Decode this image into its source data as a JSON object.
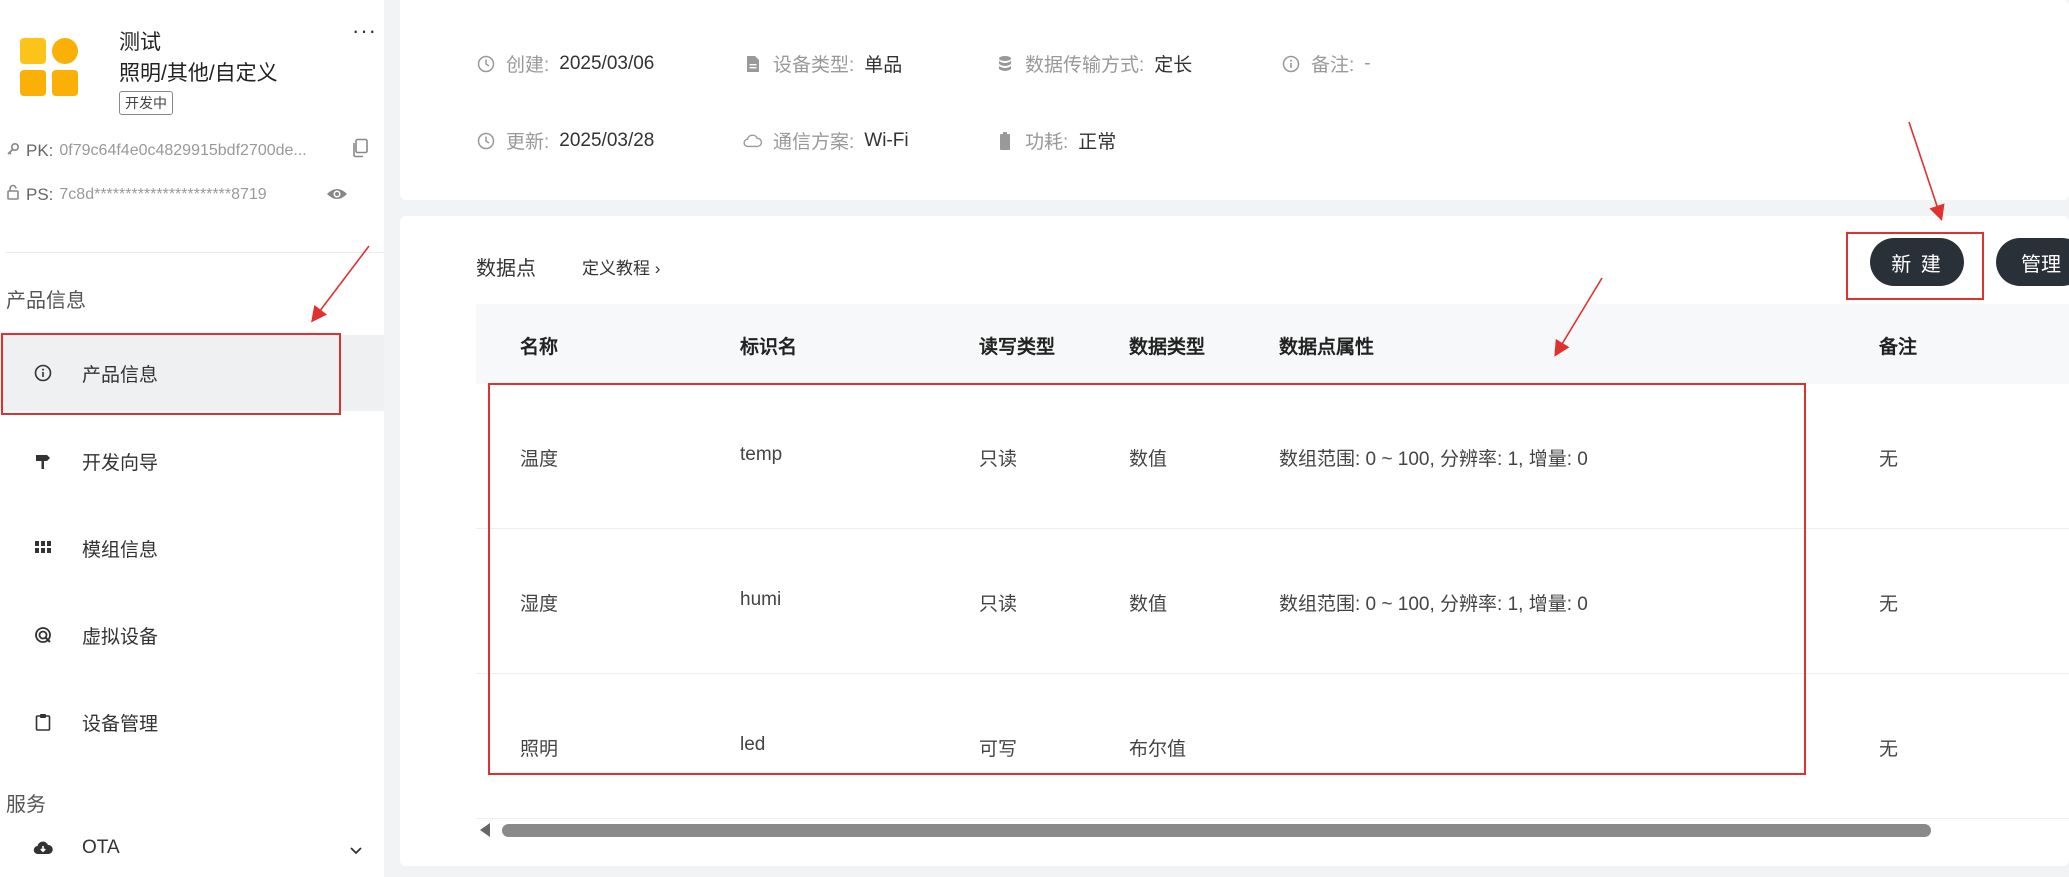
{
  "sidebar": {
    "product": {
      "name": "测试",
      "category": "照明/其他/自定义",
      "status": "开发中",
      "more": "···"
    },
    "pk_label": "PK:",
    "pk_value": "0f79c64f4e0c4829915bdf2700de...",
    "ps_label": "PS:",
    "ps_value": "7c8d**********************8719",
    "section_product": "产品信息",
    "section_service": "服务",
    "items": [
      {
        "label": "产品信息",
        "icon": "info-icon",
        "active": true
      },
      {
        "label": "开发向导",
        "icon": "signpost-icon"
      },
      {
        "label": "模组信息",
        "icon": "grid-icon"
      },
      {
        "label": "虚拟设备",
        "icon": "virtual-device-icon"
      },
      {
        "label": "设备管理",
        "icon": "clipboard-icon"
      },
      {
        "label": "OTA",
        "icon": "cloud-download-icon"
      }
    ]
  },
  "info": {
    "created_label": "创建:",
    "created_value": "2025/03/06",
    "device_type_label": "设备类型:",
    "device_type_value": "单品",
    "transfer_label": "数据传输方式:",
    "transfer_value": "定长",
    "note_label": "备注:",
    "note_value": "-",
    "updated_label": "更新:",
    "updated_value": "2025/03/28",
    "comm_label": "通信方案:",
    "comm_value": "Wi-Fi",
    "power_label": "功耗:",
    "power_value": "正常"
  },
  "datapoints": {
    "title": "数据点",
    "tutorial": "定义教程 ›",
    "new_button": "新 建",
    "manage_button": "管理",
    "columns": [
      "名称",
      "标识名",
      "读写类型",
      "数据类型",
      "数据点属性",
      "备注"
    ],
    "rows": [
      {
        "name": "温度",
        "id": "temp",
        "rw": "只读",
        "type": "数值",
        "attr": "数组范围: 0 ~ 100, 分辨率: 1, 增量: 0",
        "note": "无"
      },
      {
        "name": "湿度",
        "id": "humi",
        "rw": "只读",
        "type": "数值",
        "attr": "数组范围: 0 ~ 100, 分辨率: 1, 增量: 0",
        "note": "无"
      },
      {
        "name": "照明",
        "id": "led",
        "rw": "可写",
        "type": "布尔值",
        "attr": "",
        "note": "无"
      }
    ]
  },
  "colors": {
    "accent_dark": "#2a3038",
    "annotation_red": "#e03131",
    "logo_yellow": "#fcc419"
  }
}
